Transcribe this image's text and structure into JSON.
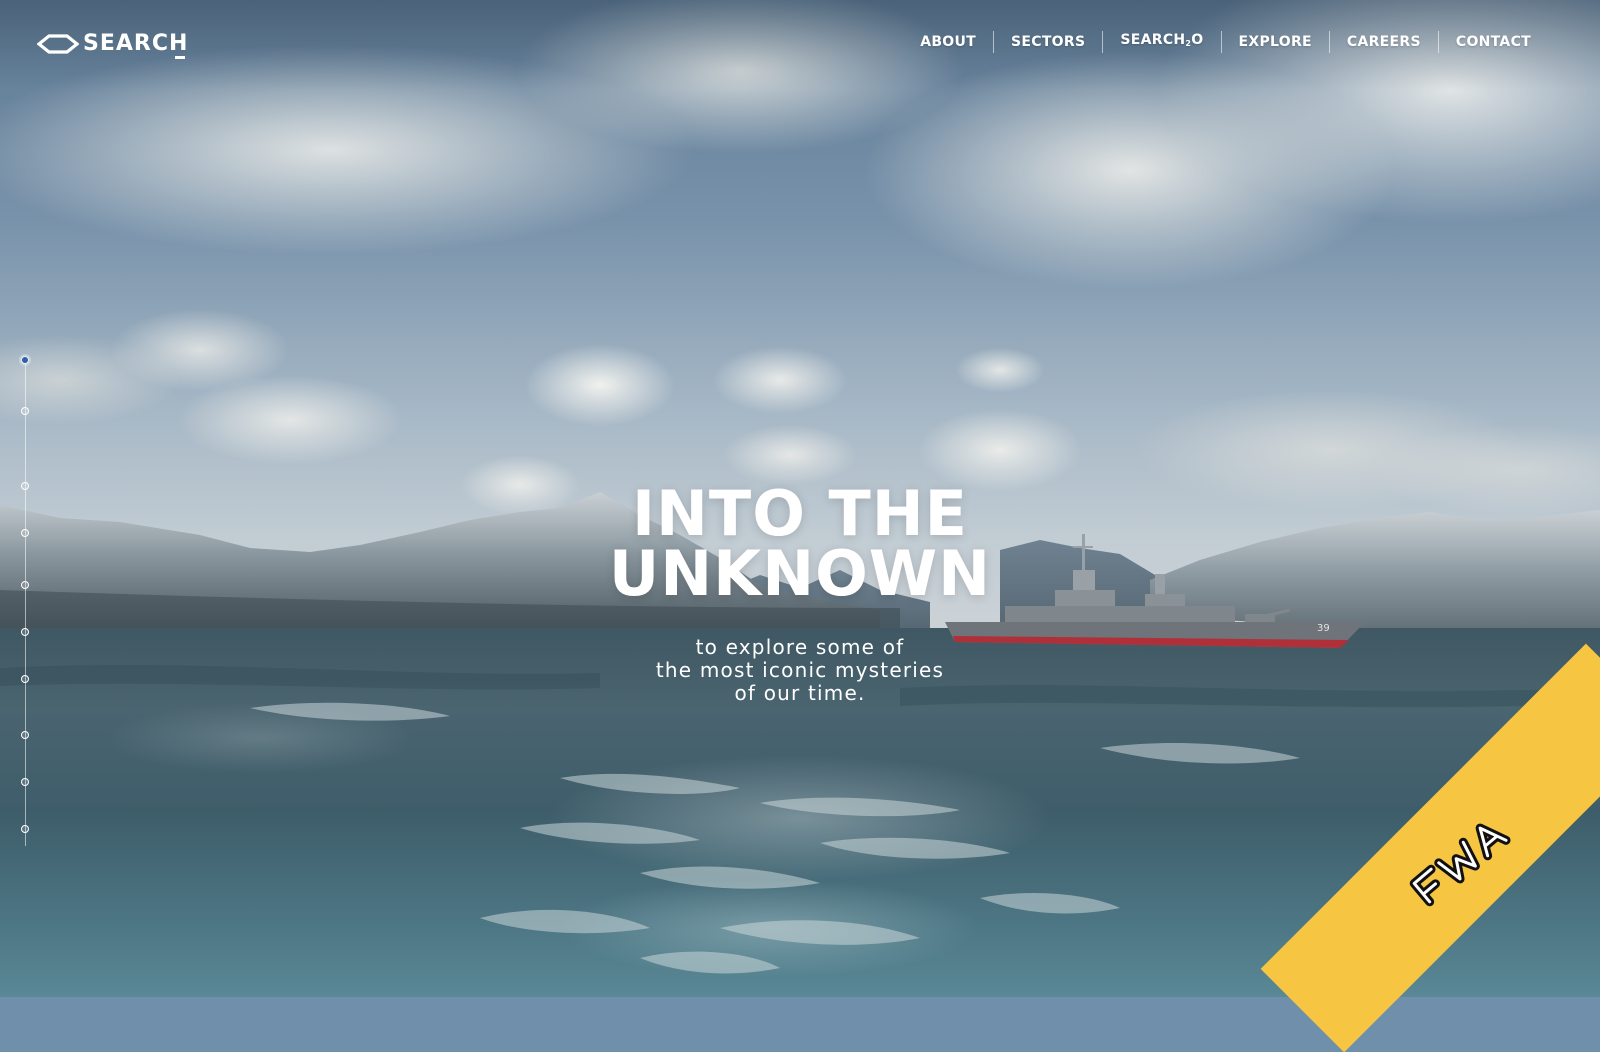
{
  "header": {
    "logo_text": "SEARCH",
    "logo_icon": "hexagon-logo-icon",
    "nav": [
      {
        "label": "ABOUT"
      },
      {
        "label": "SECTORS"
      },
      {
        "label": "SEARCH",
        "sub": "2",
        "suffix": "O"
      },
      {
        "label": "EXPLORE"
      },
      {
        "label": "CAREERS"
      },
      {
        "label": "CONTACT"
      }
    ]
  },
  "hero": {
    "title_line1": "INTO THE",
    "title_line2": "UNKNOWN",
    "subtitle_line1": "to explore some of",
    "subtitle_line2": "the most iconic mysteries",
    "subtitle_line3": "of our time."
  },
  "scene": {
    "ship_hull_number": "39"
  },
  "progress": {
    "total_sections": 10,
    "active_section": 1
  },
  "badge": {
    "text": "FWA",
    "color": "#f6c542"
  }
}
